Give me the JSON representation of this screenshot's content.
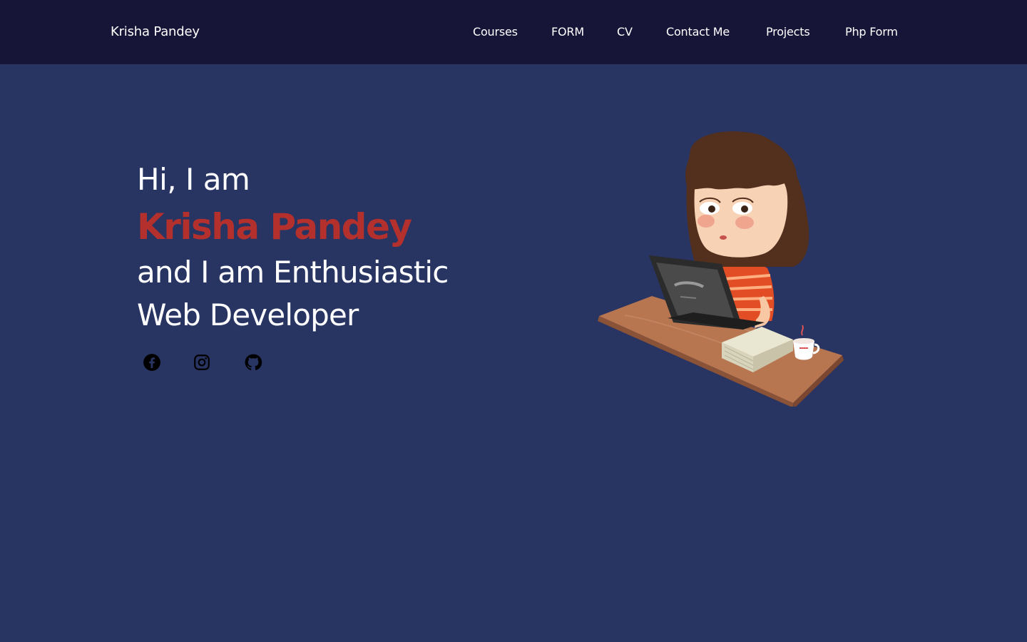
{
  "header": {
    "brand": "Krisha Pandey",
    "nav": [
      {
        "label": "Courses"
      },
      {
        "label": "FORM"
      },
      {
        "label": "CV"
      },
      {
        "label": "Contact Me"
      },
      {
        "label": "Projects"
      },
      {
        "label": "Php Form"
      }
    ]
  },
  "hero": {
    "greeting": "Hi, I am",
    "name": "Krisha Pandey",
    "tagline_line1": "and I am Enthusiastic",
    "tagline_line2": "Web Developer",
    "socials": [
      {
        "icon": "facebook-icon"
      },
      {
        "icon": "instagram-icon"
      },
      {
        "icon": "github-icon"
      }
    ],
    "illustration": "girl-working-on-laptop-illustration"
  },
  "colors": {
    "navbar_bg": "#161537",
    "page_bg": "#283462",
    "accent": "#b4302d",
    "text": "#ffffff"
  }
}
